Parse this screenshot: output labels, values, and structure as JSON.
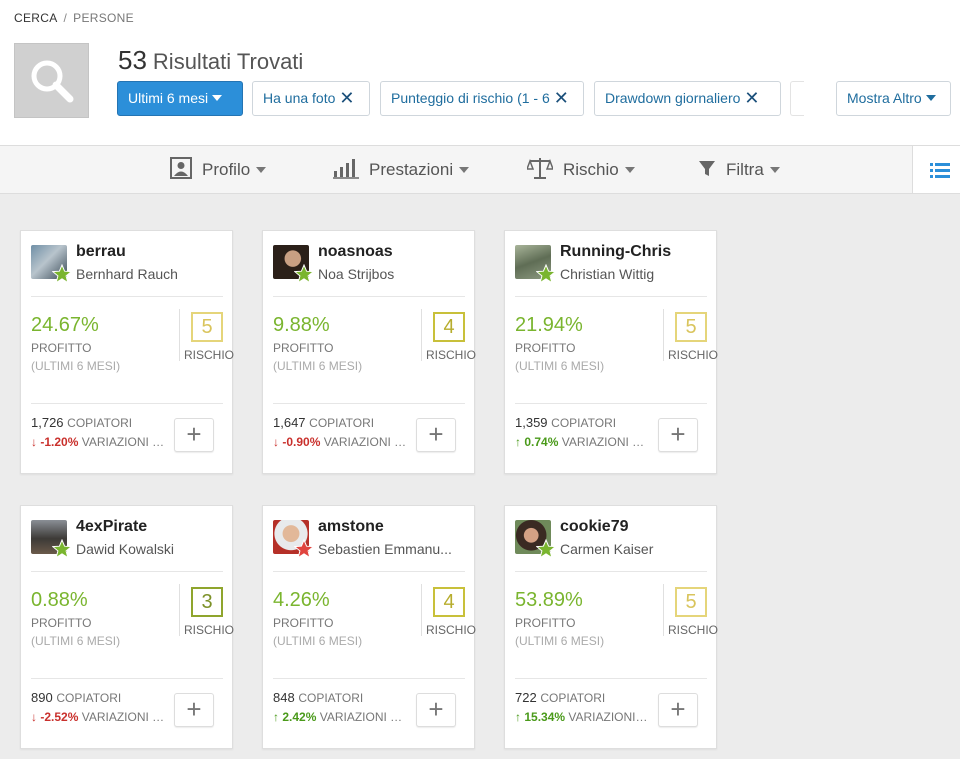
{
  "breadcrumb": {
    "root": "CERCA",
    "separator": "/",
    "current": "PERSONE"
  },
  "results": {
    "count": "53",
    "label": "Risultati Trovati"
  },
  "filters": {
    "period": "Ultimi 6 mesi",
    "chips": [
      "Ha una foto",
      "Punteggio di rischio (1 - 6",
      "Drawdown giornaliero"
    ],
    "more": "Mostra Altro"
  },
  "toolbar": {
    "profile": "Profilo",
    "performance": "Prestazioni",
    "risk": "Rischio",
    "filter": "Filtra"
  },
  "labels": {
    "profit": "PROFITTO",
    "period": "(ULTIMI 6 MESI)",
    "risk": "RISCHIO",
    "copiers": "COPIATORI",
    "change_a": "VARIAZIONI C...",
    "change_b": "VARIAZIONI CO..."
  },
  "colors": {
    "accent": "#2c8fd9",
    "profit": "#7ab52f",
    "negative": "#c9302c",
    "positive": "#4a9a1a",
    "star_green": "#7ab52f",
    "star_red": "#e0443e"
  },
  "cards": [
    {
      "username": "berrau",
      "name": "Bernhard Rauch",
      "profit": "24.67%",
      "risk": "5",
      "copiers": "1,726",
      "change": "-1.20%",
      "trend": "down",
      "star": "green"
    },
    {
      "username": "noasnoas",
      "name": "Noa Strijbos",
      "profit": "9.88%",
      "risk": "4",
      "copiers": "1,647",
      "change": "-0.90%",
      "trend": "down",
      "star": "green"
    },
    {
      "username": "Running-Chris",
      "name": "Christian Wittig",
      "profit": "21.94%",
      "risk": "5",
      "copiers": "1,359",
      "change": "0.74%",
      "trend": "up",
      "star": "green"
    },
    {
      "username": "4exPirate",
      "name": "Dawid Kowalski",
      "profit": "0.88%",
      "risk": "3",
      "copiers": "890",
      "change": "-2.52%",
      "trend": "down",
      "star": "green"
    },
    {
      "username": "amstone",
      "name": "Sebastien Emmanu...",
      "profit": "4.26%",
      "risk": "4",
      "copiers": "848",
      "change": "2.42%",
      "trend": "up",
      "star": "red"
    },
    {
      "username": "cookie79",
      "name": "Carmen Kaiser",
      "profit": "53.89%",
      "risk": "5",
      "copiers": "722",
      "change": "15.34%",
      "trend": "up",
      "star": "green"
    }
  ]
}
